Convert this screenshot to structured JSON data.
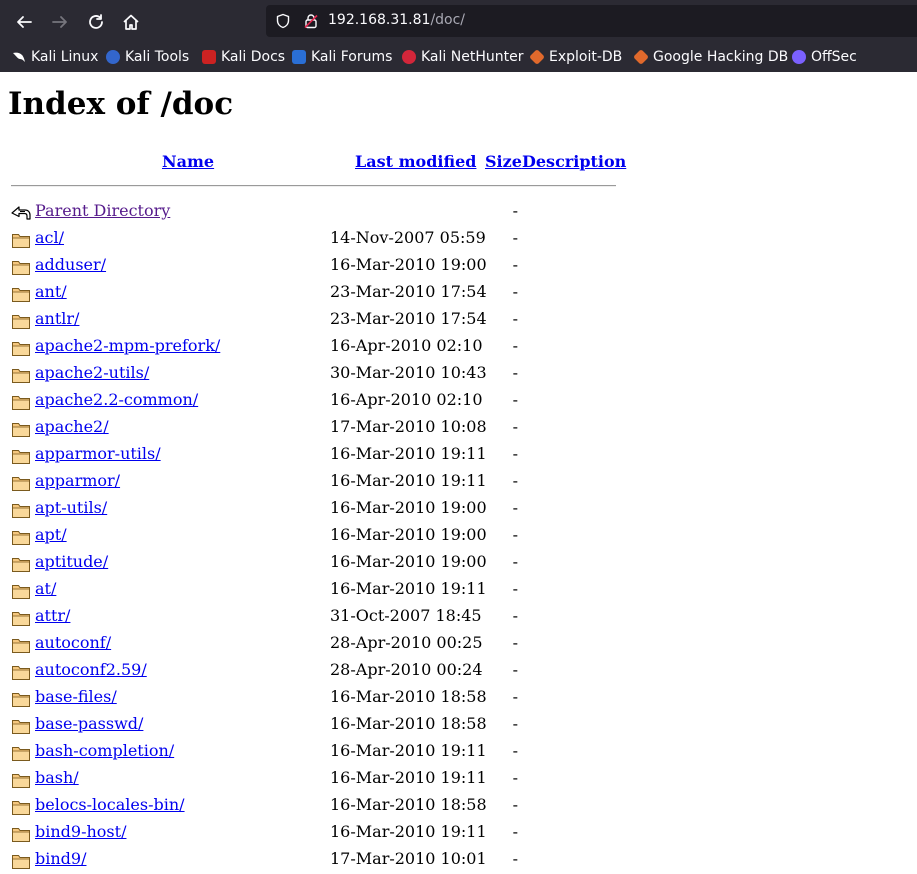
{
  "browser": {
    "url_host": "192.168.31.81",
    "url_path": "/doc/",
    "bookmarks": [
      {
        "label": "Kali Linux",
        "icon": "kali-dragon-icon"
      },
      {
        "label": "Kali Tools",
        "icon": "kali-tools-icon"
      },
      {
        "label": "Kali Docs",
        "icon": "kali-docs-icon"
      },
      {
        "label": "Kali Forums",
        "icon": "kali-forums-icon"
      },
      {
        "label": "Kali NetHunter",
        "icon": "kali-nethunter-icon"
      },
      {
        "label": "Exploit-DB",
        "icon": "exploit-db-icon"
      },
      {
        "label": "Google Hacking DB",
        "icon": "google-hacking-db-icon"
      },
      {
        "label": "OffSec",
        "icon": "offsec-icon"
      }
    ]
  },
  "listing": {
    "title": "Index of /doc",
    "columns": {
      "name": "Name",
      "modified": "Last modified",
      "size": "Size",
      "description": "Description"
    },
    "parent": {
      "name": "Parent Directory",
      "size": "-"
    },
    "entries": [
      {
        "name": "acl/",
        "modified": "14-Nov-2007 05:59",
        "size": "-"
      },
      {
        "name": "adduser/",
        "modified": "16-Mar-2010 19:00",
        "size": "-"
      },
      {
        "name": "ant/",
        "modified": "23-Mar-2010 17:54",
        "size": "-"
      },
      {
        "name": "antlr/",
        "modified": "23-Mar-2010 17:54",
        "size": "-"
      },
      {
        "name": "apache2-mpm-prefork/",
        "modified": "16-Apr-2010 02:10",
        "size": "-"
      },
      {
        "name": "apache2-utils/",
        "modified": "30-Mar-2010 10:43",
        "size": "-"
      },
      {
        "name": "apache2.2-common/",
        "modified": "16-Apr-2010 02:10",
        "size": "-"
      },
      {
        "name": "apache2/",
        "modified": "17-Mar-2010 10:08",
        "size": "-"
      },
      {
        "name": "apparmor-utils/",
        "modified": "16-Mar-2010 19:11",
        "size": "-"
      },
      {
        "name": "apparmor/",
        "modified": "16-Mar-2010 19:11",
        "size": "-"
      },
      {
        "name": "apt-utils/",
        "modified": "16-Mar-2010 19:00",
        "size": "-"
      },
      {
        "name": "apt/",
        "modified": "16-Mar-2010 19:00",
        "size": "-"
      },
      {
        "name": "aptitude/",
        "modified": "16-Mar-2010 19:00",
        "size": "-"
      },
      {
        "name": "at/",
        "modified": "16-Mar-2010 19:11",
        "size": "-"
      },
      {
        "name": "attr/",
        "modified": "31-Oct-2007 18:45",
        "size": "-"
      },
      {
        "name": "autoconf/",
        "modified": "28-Apr-2010 00:25",
        "size": "-"
      },
      {
        "name": "autoconf2.59/",
        "modified": "28-Apr-2010 00:24",
        "size": "-"
      },
      {
        "name": "base-files/",
        "modified": "16-Mar-2010 18:58",
        "size": "-"
      },
      {
        "name": "base-passwd/",
        "modified": "16-Mar-2010 18:58",
        "size": "-"
      },
      {
        "name": "bash-completion/",
        "modified": "16-Mar-2010 19:11",
        "size": "-"
      },
      {
        "name": "bash/",
        "modified": "16-Mar-2010 19:11",
        "size": "-"
      },
      {
        "name": "belocs-locales-bin/",
        "modified": "16-Mar-2010 18:58",
        "size": "-"
      },
      {
        "name": "bind9-host/",
        "modified": "16-Mar-2010 19:11",
        "size": "-"
      },
      {
        "name": "bind9/",
        "modified": "17-Mar-2010 10:01",
        "size": "-"
      }
    ]
  }
}
